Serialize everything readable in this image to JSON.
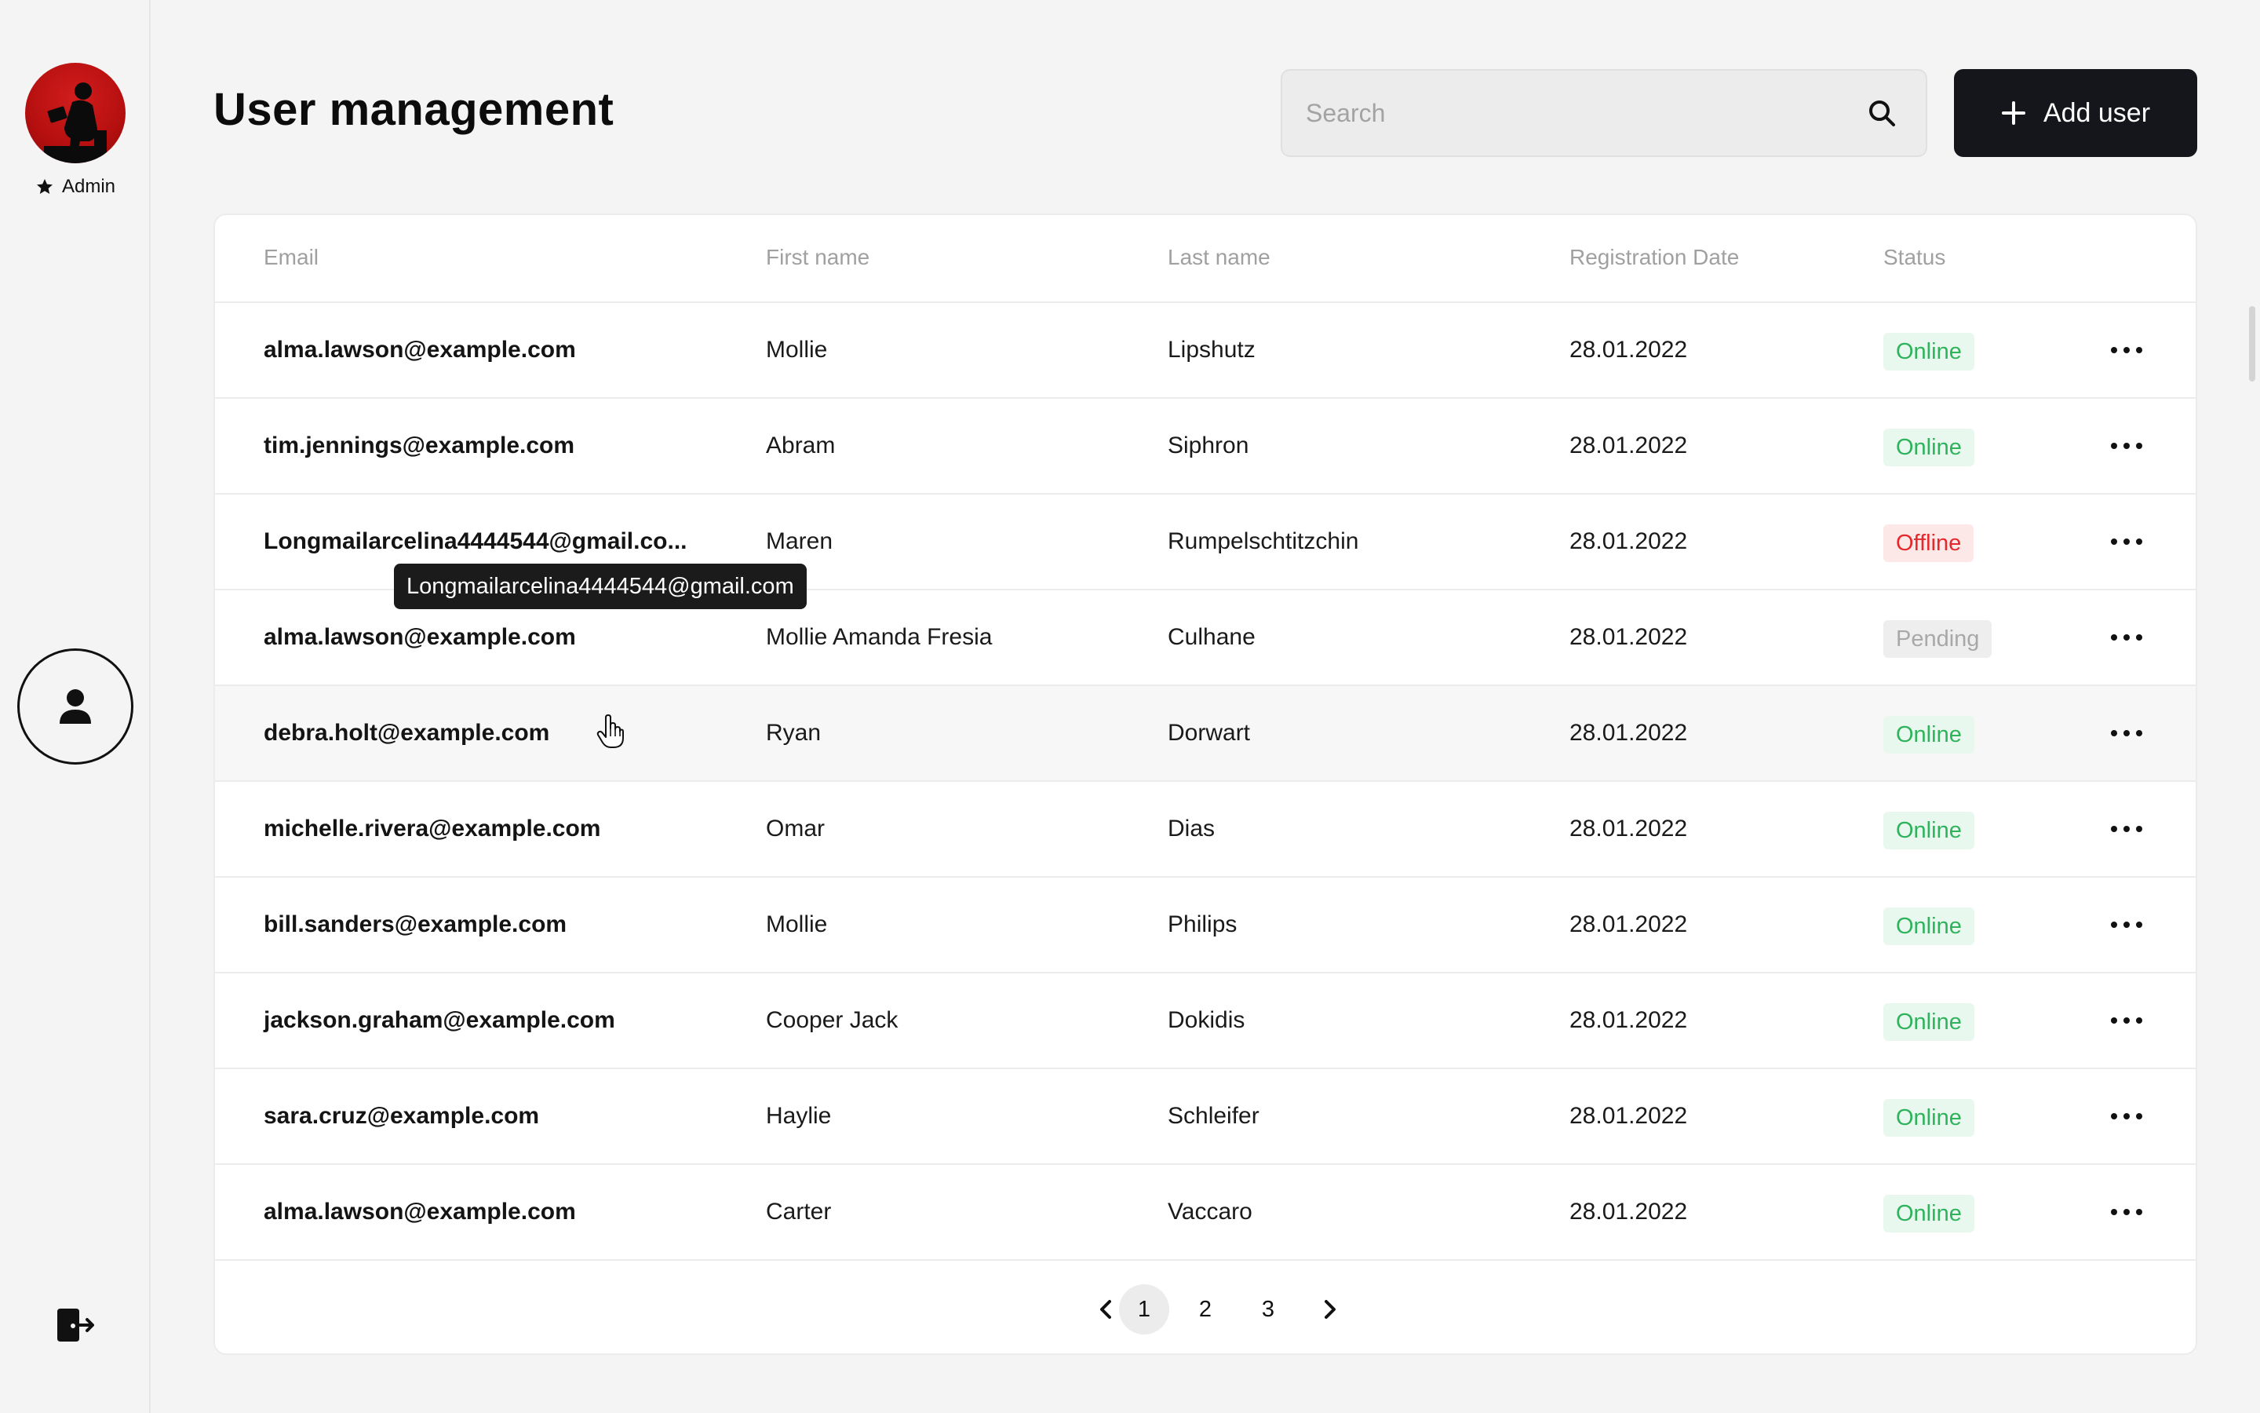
{
  "sidebar": {
    "role_label": "Admin"
  },
  "header": {
    "title": "User management",
    "search_placeholder": "Search",
    "add_user_label": "Add user"
  },
  "table": {
    "columns": [
      "Email",
      "First name",
      "Last name",
      "Registration Date",
      "Status"
    ],
    "rows": [
      {
        "email": "alma.lawson@example.com",
        "first": "Mollie",
        "last": "Lipshutz",
        "date": "28.01.2022",
        "status": "Online"
      },
      {
        "email": "tim.jennings@example.com",
        "first": "Abram",
        "last": "Siphron",
        "date": "28.01.2022",
        "status": "Online"
      },
      {
        "email": "Longmailarcelina4444544@gmail.co...",
        "first": "Maren",
        "last": "Rumpelschtitzchin",
        "date": "28.01.2022",
        "status": "Offline"
      },
      {
        "email": "alma.lawson@example.com",
        "first": "Mollie Amanda Fresia",
        "last": "Culhane",
        "date": "28.01.2022",
        "status": "Pending"
      },
      {
        "email": "debra.holt@example.com",
        "first": "Ryan",
        "last": "Dorwart",
        "date": "28.01.2022",
        "status": "Online"
      },
      {
        "email": "michelle.rivera@example.com",
        "first": "Omar",
        "last": "Dias",
        "date": "28.01.2022",
        "status": "Online"
      },
      {
        "email": "bill.sanders@example.com",
        "first": "Mollie",
        "last": "Philips",
        "date": "28.01.2022",
        "status": "Online"
      },
      {
        "email": "jackson.graham@example.com",
        "first": "Cooper Jack",
        "last": "Dokidis",
        "date": "28.01.2022",
        "status": "Online"
      },
      {
        "email": "sara.cruz@example.com",
        "first": "Haylie",
        "last": "Schleifer",
        "date": "28.01.2022",
        "status": "Online"
      },
      {
        "email": "alma.lawson@example.com",
        "first": "Carter",
        "last": "Vaccaro",
        "date": "28.01.2022",
        "status": "Online"
      }
    ]
  },
  "tooltip": {
    "text": "Longmailarcelina4444544@gmail.com"
  },
  "pagination": {
    "pages": [
      "1",
      "2",
      "3"
    ],
    "current": "1"
  },
  "colors": {
    "online_text": "#2eb35c",
    "online_bg": "#e9f8ee",
    "offline_text": "#e4282b",
    "offline_bg": "#fde8e8",
    "pending_text": "#a8a8a8",
    "pending_bg": "#eeeeee",
    "primary_button": "#14161b",
    "avatar_red": "#c81414"
  },
  "icons": {
    "role": "star-icon",
    "nav": "user-icon",
    "logout": "logout-icon",
    "search": "search-icon",
    "add": "plus-icon",
    "row_actions": "more-horizontal-icon",
    "prev": "chevron-left-icon",
    "next": "chevron-right-icon"
  }
}
